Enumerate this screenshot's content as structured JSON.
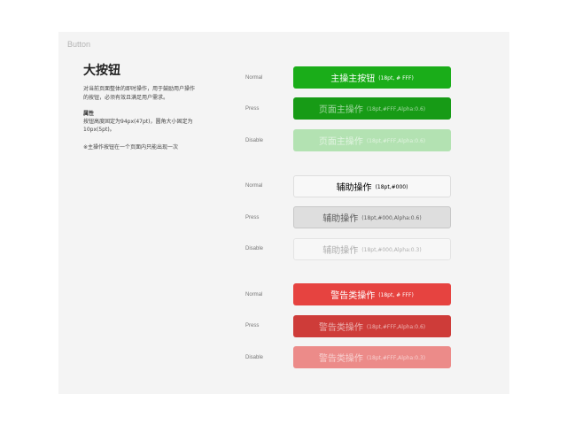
{
  "section_label": "Button",
  "title": "大按钮",
  "description": {
    "line1": "对当前页面整体的即时操作，用于鼓励用户操作",
    "line2": "的按钮，必须有效且满足用户需求。",
    "attr_heading": "属性",
    "attr1": "按钮高度固定为94px(47pt)，圆角大小固定为",
    "attr2": "10px(5pt)。",
    "note": "※主操作按钮在一个页面内只能出现一次"
  },
  "rows": {
    "g1": {
      "state": "Normal",
      "label": "主操主按钮",
      "sub": "(18pt, # FFF)"
    },
    "g2": {
      "state": "Press",
      "label": "页面主操作",
      "sub": "(18pt,#FFF,Alpha:0.6)"
    },
    "g3": {
      "state": "Disable",
      "label": "页面主操作",
      "sub": "(18pt,#FFF,Alpha:0.6)"
    },
    "w1": {
      "state": "Normal",
      "label": "辅助操作",
      "sub": "(18pt,#000)"
    },
    "w2": {
      "state": "Press",
      "label": "辅助操作",
      "sub": "(18pt,#000,Alpha:0.6)"
    },
    "w3": {
      "state": "Disable",
      "label": "辅助操作",
      "sub": "(18pt,#000,Alpha:0.3)"
    },
    "r1": {
      "state": "Normal",
      "label": "警告类操作",
      "sub": "(18pt, # FFF)"
    },
    "r2": {
      "state": "Press",
      "label": "警告类操作",
      "sub": "(18pt,#FFF,Alpha:0.6)"
    },
    "r3": {
      "state": "Disable",
      "label": "警告类操作",
      "sub": "(18pt,#FFF,Alpha:0.3)"
    }
  },
  "colors": {
    "primary": "#1aad19",
    "primary_press": "#179b16",
    "primary_disable": "#b3e2b2",
    "default_bg": "#f8f8f8",
    "warn": "#e64340",
    "warn_press": "#ce3c39",
    "warn_disable": "#ec8b89"
  }
}
